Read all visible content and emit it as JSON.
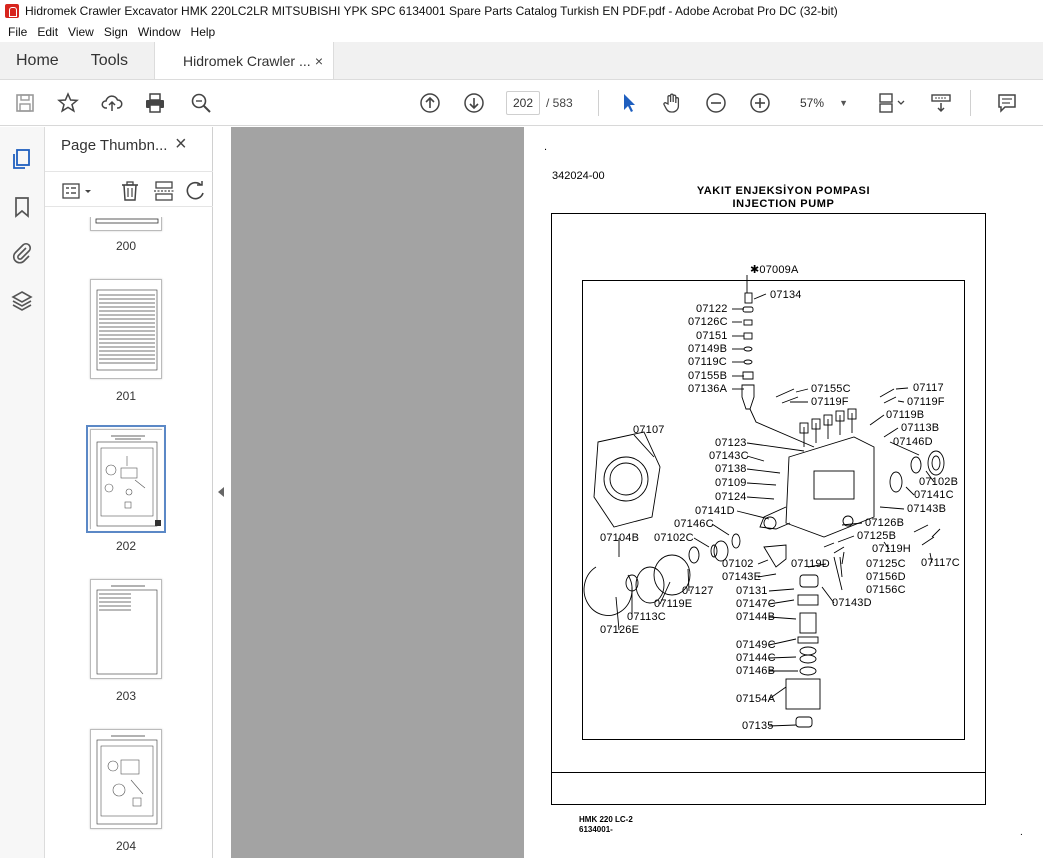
{
  "window": {
    "title": "Hidromek Crawler Excavator HMK 220LC2LR MITSUBISHI YPK SPC 6134001 Spare Parts Catalog Turkish EN PDF.pdf - Adobe Acrobat Pro DC (32-bit)"
  },
  "menu": [
    "File",
    "Edit",
    "View",
    "Sign",
    "Window",
    "Help"
  ],
  "tabs": {
    "home": "Home",
    "tools": "Tools",
    "document": "Hidromek Crawler ...",
    "close": "×"
  },
  "toolbar": {
    "page_current": "202",
    "page_total": "/ 583",
    "zoom": "57%",
    "icons": [
      "save-icon",
      "bookmark-star-icon",
      "upload-cloud-icon",
      "print-icon",
      "zoom-search-icon",
      "page-up-icon",
      "page-down-icon",
      "select-cursor-icon",
      "hand-icon",
      "zoom-out-icon",
      "zoom-in-icon",
      "fit-page-icon",
      "scroll-mode-icon",
      "comment-icon"
    ]
  },
  "thumbnails": {
    "header": "Page Thumbn...",
    "close": "×",
    "pages": [
      {
        "label": "200"
      },
      {
        "label": "201"
      },
      {
        "label": "202",
        "selected": true
      },
      {
        "label": "203"
      },
      {
        "label": "204"
      }
    ]
  },
  "pdf": {
    "dot": ".",
    "code": "342024-00",
    "title_tr": "YAKIT ENJEKSİYON POMPASI",
    "title_en": "INJECTION PUMP",
    "footer_model": "HMK 220 LC-2",
    "footer_code": "6134001-",
    "footer_dot": ".",
    "parts": [
      {
        "label": "✱07009A"
      },
      {
        "label": "07134"
      },
      {
        "label": "07122"
      },
      {
        "label": "07126C"
      },
      {
        "label": "07151"
      },
      {
        "label": "07149B"
      },
      {
        "label": "07119C"
      },
      {
        "label": "07155B"
      },
      {
        "label": "07136A"
      },
      {
        "label": "07155C"
      },
      {
        "label": "07119F"
      },
      {
        "label": "07117"
      },
      {
        "label": "07119F"
      },
      {
        "label": "07119B"
      },
      {
        "label": "07113B"
      },
      {
        "label": "07146D"
      },
      {
        "label": "07107"
      },
      {
        "label": "07123"
      },
      {
        "label": "07143C"
      },
      {
        "label": "07138"
      },
      {
        "label": "07109"
      },
      {
        "label": "07124"
      },
      {
        "label": "07102B"
      },
      {
        "label": "07141C"
      },
      {
        "label": "07143B"
      },
      {
        "label": "07141D"
      },
      {
        "label": "07146C"
      },
      {
        "label": "07126B"
      },
      {
        "label": "07104B"
      },
      {
        "label": "07102C"
      },
      {
        "label": "07125B"
      },
      {
        "label": "07119H"
      },
      {
        "label": "07117C"
      },
      {
        "label": "07102"
      },
      {
        "label": "07119D"
      },
      {
        "label": "07125C"
      },
      {
        "label": "07143E"
      },
      {
        "label": "07156D"
      },
      {
        "label": "07127"
      },
      {
        "label": "07131"
      },
      {
        "label": "07156C"
      },
      {
        "label": "07119E"
      },
      {
        "label": "07147C"
      },
      {
        "label": "07143D"
      },
      {
        "label": "07113C"
      },
      {
        "label": "07144B"
      },
      {
        "label": "07126E"
      },
      {
        "label": "07149C"
      },
      {
        "label": "07144C"
      },
      {
        "label": "07146B"
      },
      {
        "label": "07154A"
      },
      {
        "label": "07135"
      }
    ]
  }
}
